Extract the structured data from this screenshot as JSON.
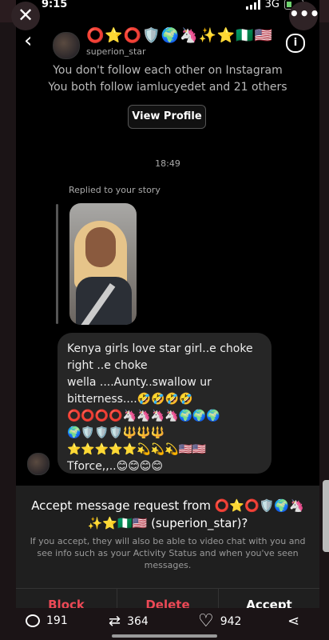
{
  "viewer": {
    "close_glyph": "✕",
    "more_glyph": "•••"
  },
  "status": {
    "time": "9:15",
    "network": "3G"
  },
  "header": {
    "back_glyph": "‹",
    "display_name": "⭕⭐⭕🛡️🌍🦄✨⭐🇳🇬🇺🇸",
    "username": "superion_star",
    "info_glyph": "i"
  },
  "follow_info": {
    "line1": "You don't follow each other on Instagram",
    "line2": "You both follow iamlucyedet and 21 others"
  },
  "view_profile_label": "View Profile",
  "conversation": {
    "timestamp": "18:49",
    "replied_label": "Replied to your story",
    "message_lines": [
      "Kenya girls love star girl..e choke",
      "right ..e choke",
      "wella ....Aunty..swallow ur",
      "bitterness....🤣🤣🤣🤣",
      "⭕⭕⭕⭕🦄🦄🦄🦄🌍🌍🌍",
      "🌍🛡️🛡️🛡️🔱🔱🔱",
      "⭐⭐⭐⭐⭐💫💫💫🇺🇸🇺🇸",
      "Tforce,,..😊😊😊😊"
    ]
  },
  "request": {
    "title": "Accept message request from ⭕⭐⭕🛡️🌍🦄✨⭐🇳🇬🇺🇸 (superion_star)?",
    "body": "If you accept, they will also be able to video chat with you and see info such as your Activity Status and when you've seen messages.",
    "block_label": "Block",
    "delete_label": "Delete",
    "accept_label": "Accept"
  },
  "engagement": {
    "comments": "191",
    "retweets": "364",
    "likes": "942"
  },
  "icons": {
    "comment": "comment-icon",
    "retweet": "retweet-icon",
    "like": "heart-icon",
    "share": "share-icon"
  },
  "colors": {
    "danger": "#ed4956",
    "bubble": "#262626",
    "panel": "#1f1f1f"
  }
}
